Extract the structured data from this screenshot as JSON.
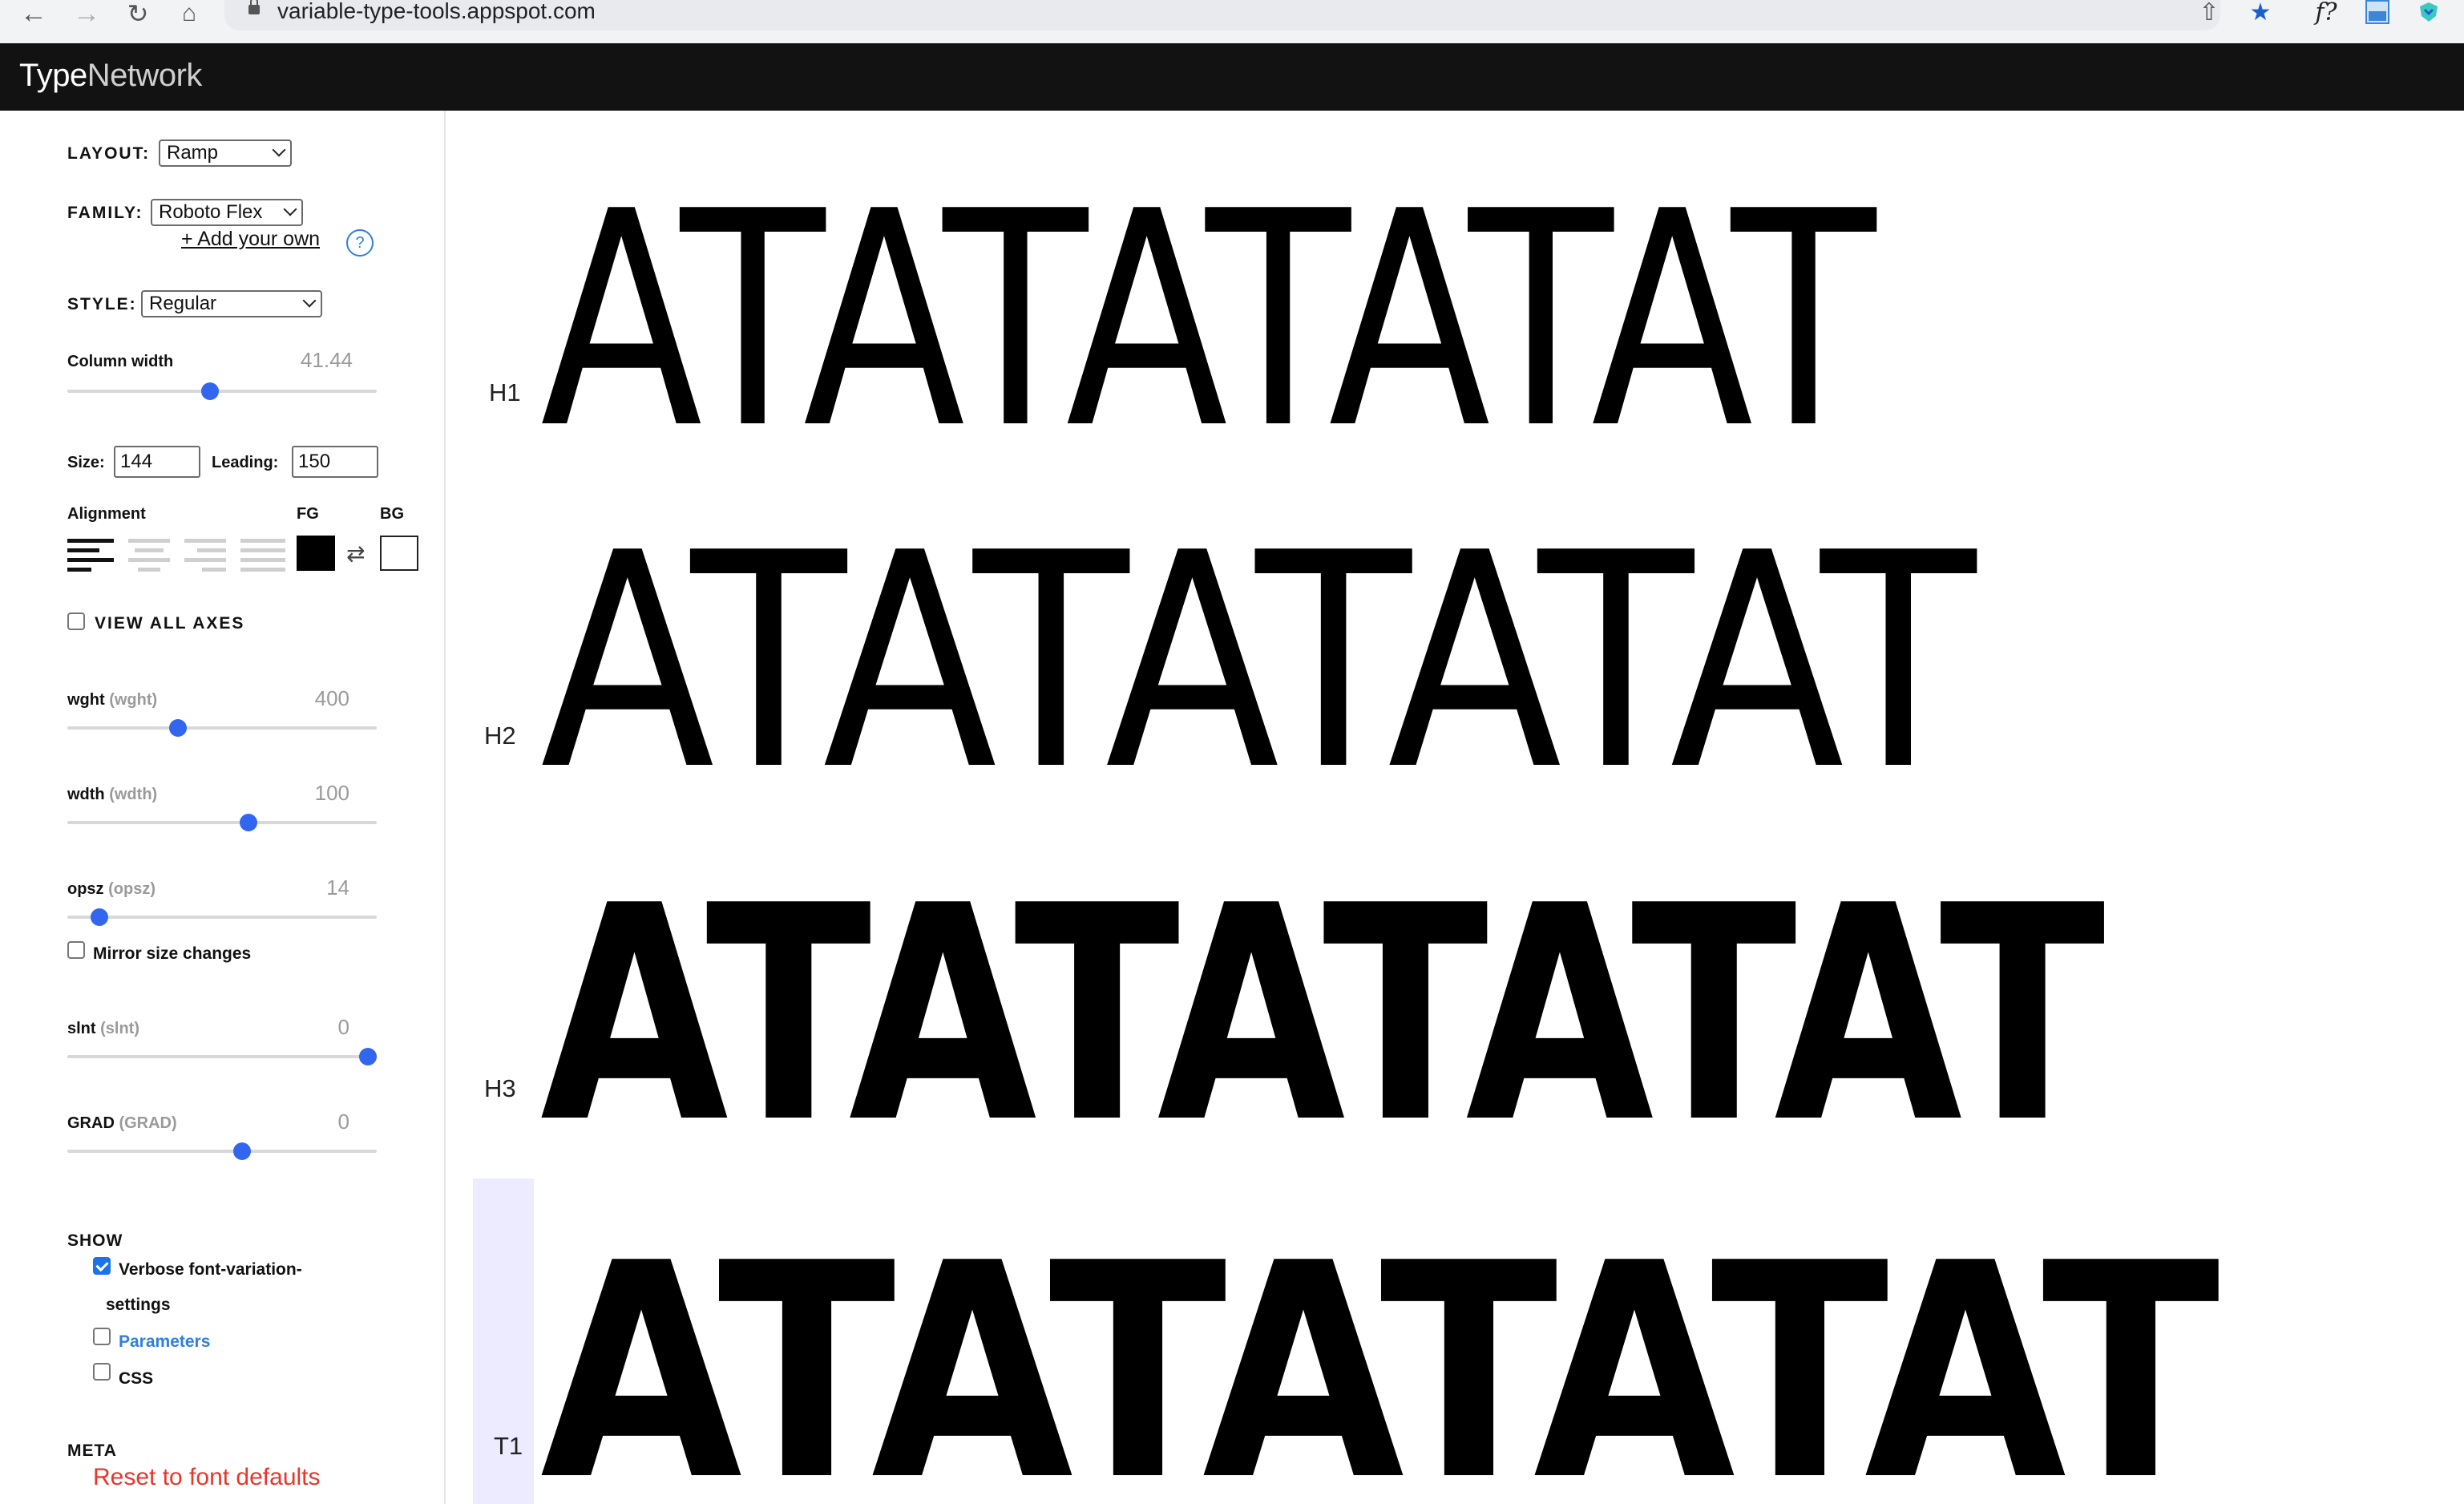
{
  "browser": {
    "url": "variable-type-tools.appspot.com",
    "icons": [
      "back-icon",
      "forward-icon",
      "reload-icon",
      "home-icon",
      "lock-icon",
      "share-icon",
      "star-icon",
      "fontfx-extension-icon",
      "extension-icon",
      "shield-extension-icon"
    ],
    "fontfx_glyph": "f?"
  },
  "header": {
    "logo_part1": "Type",
    "logo_part2": "Network"
  },
  "sidebar": {
    "layout_label": "LAYOUT:",
    "layout_value": "Ramp",
    "family_label": "FAMILY:",
    "family_value": "Roboto Flex",
    "add_own": "+ Add your own",
    "help": "?",
    "style_label": "STYLE:",
    "style_value": "Regular",
    "column_width_label": "Column width",
    "column_width_value": "41.44",
    "column_width_fraction": 0.46,
    "size_label": "Size:",
    "size_value": "144",
    "leading_label": "Leading:",
    "leading_value": "150",
    "alignment_label": "Alignment",
    "fg_label": "FG",
    "bg_label": "BG",
    "fg_color": "#000000",
    "bg_color": "#ffffff",
    "swap_glyph": "⇄",
    "view_all_axes": "VIEW ALL AXES",
    "axes": [
      {
        "name": "wght",
        "tag": "(wght)",
        "value": "400",
        "fraction": 0.35
      },
      {
        "name": "wdth",
        "tag": "(wdth)",
        "value": "100",
        "fraction": 0.59
      },
      {
        "name": "opsz",
        "tag": "(opsz)",
        "value": "14",
        "fraction": 0.08
      },
      {
        "name": "slnt",
        "tag": "(slnt)",
        "value": "0",
        "fraction": 1.0
      },
      {
        "name": "GRAD",
        "tag": "(GRAD)",
        "value": "0",
        "fraction": 0.57
      }
    ],
    "mirror_size": "Mirror size changes",
    "show_label": "SHOW",
    "show_verbose_line1": "Verbose font-variation-",
    "show_verbose_line2": "settings",
    "show_parameters": "Parameters",
    "show_css": "CSS",
    "meta_label": "META",
    "reset_link": "Reset to font defaults",
    "accent_color": "#3366ee",
    "link_color": "#2f7fe0",
    "reset_color": "#e8362a"
  },
  "main": {
    "rows": [
      {
        "label": "H1",
        "text": "ATATATATAT"
      },
      {
        "label": "H2",
        "text": "ATATATATAT"
      },
      {
        "label": "H3",
        "text": "ATATATATAT"
      },
      {
        "label": "T1",
        "text": "ATATATATAT"
      }
    ],
    "highlight_color": "#ecebff"
  }
}
